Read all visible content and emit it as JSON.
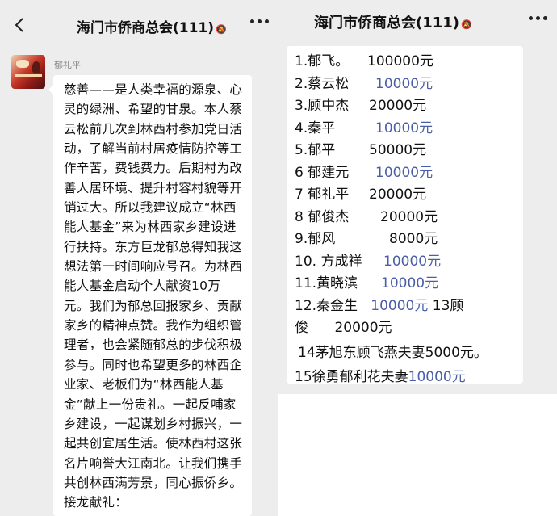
{
  "left": {
    "title": "海门市侨商总会",
    "count": "(111)",
    "sender": "郁礼平",
    "message": "慈善——是人类幸福的源泉、心灵的绿洲、希望的甘泉。本人蔡云松前几次到林西村参加党日活动，了解当前村居疫情防控等工作辛苦，费钱费力。后期村为改善人居环境、提升村容村貌等开销过大。所以我建议成立“林西能人基金”来为林西家乡建设进行扶持。东方巨龙郁总得知我这想法第一时间响应号召。为林西能人基金启动个人献资10万元。我们为郁总回报家乡、贡献家乡的精神点赞。我作为组织管理者，也会紧随郁总的步伐积极参与。同时也希望更多的林西企业家、老板们为“林西能人基金”献上一份贵礼。一起反哺家乡建设，一起谋划乡村振兴，一起共创宜居生活。使林西村这张名片响誉大江南北。让我们携手共创林西满芳景，同心振侨乡。接龙献礼："
  },
  "right": {
    "title": "海门市侨商总会",
    "count": "(111)",
    "entries": [
      {
        "name": "1.郁飞。",
        "amount": "100000元",
        "blue": false
      },
      {
        "name": "2.蔡云松",
        "amount": "10000元",
        "blue": true
      },
      {
        "name": "3.顾中杰",
        "amount": "20000元",
        "blue": false
      },
      {
        "name": "4.秦平",
        "amount": "10000元",
        "blue": true
      },
      {
        "name": "5.郁平",
        "amount": "50000元",
        "blue": false
      },
      {
        "name": "6 郁建元",
        "amount": "10000元",
        "blue": true
      },
      {
        "name": "7 郁礼平",
        "amount": "20000元",
        "blue": false
      },
      {
        "name": "8 郁俊杰",
        "amount": "20000元",
        "blue": false
      },
      {
        "name": "9.郁风",
        "amount": "8000元",
        "blue": false
      },
      {
        "name": "10. 方成祥",
        "amount": "10000元",
        "blue": true
      },
      {
        "name": "11.黄晓滨",
        "amount": "10000元",
        "blue": true
      }
    ],
    "entry12_name": "12.秦金生",
    "entry12_amount": "10000元",
    "entry13": "13顾俊",
    "entry13_amount": "20000元",
    "entry14": "14茅旭东顾飞燕夫妻5000元。",
    "entry15_name": "15徐勇郁利花夫妻",
    "entry15_amount": "10000元"
  }
}
